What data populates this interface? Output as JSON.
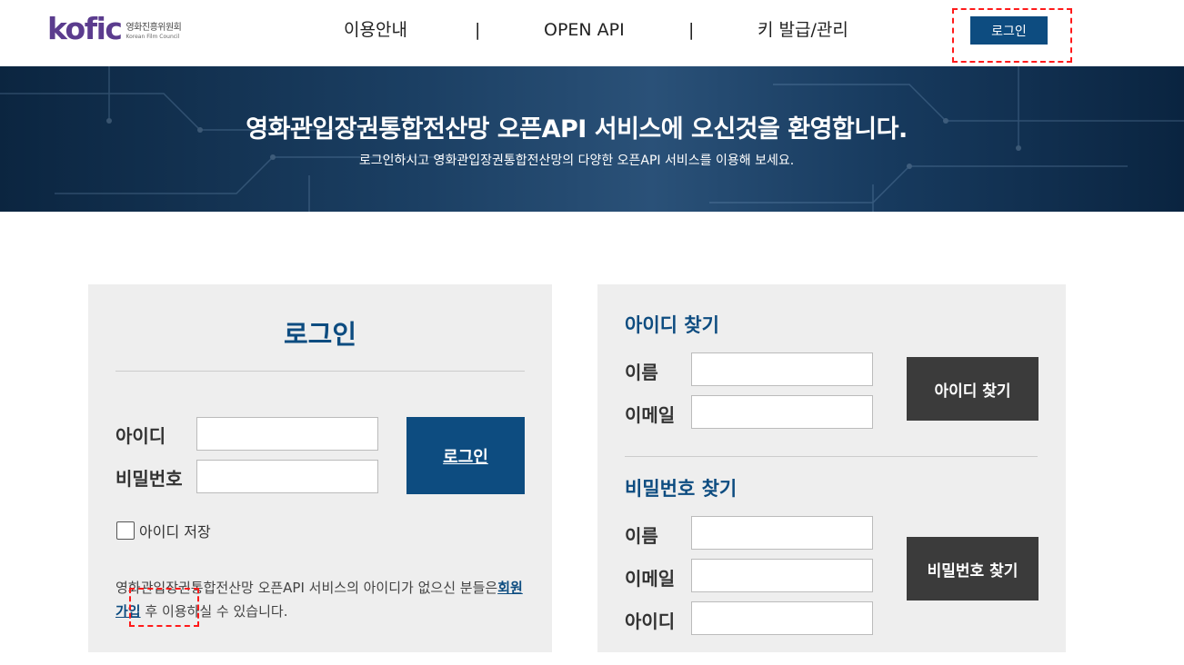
{
  "header": {
    "logo_word": "kofic",
    "logo_ko": "영화진흥위원회",
    "logo_en": "Korean Film Council",
    "nav": [
      "이용안내",
      "OPEN API",
      "키 발급/관리"
    ],
    "nav_separator": "|",
    "login_button": "로그인"
  },
  "banner": {
    "title": "영화관입장권통합전산망 오픈API 서비스에 오신것을 환영합니다.",
    "subtitle": "로그인하시고 영화관입장권통합전산망의 다양한 오픈API 서비스를 이용해 보세요."
  },
  "login": {
    "title": "로그인",
    "id_label": "아이디",
    "password_label": "비밀번호",
    "id_value": "",
    "password_value": "",
    "submit_label": "로그인",
    "remember_label": "아이디 저장",
    "remember_checked": false,
    "signup_text_1": "영화관입장권통합전산망 오픈API 서비스의 아이디가 없으신 분들은",
    "signup_link": "회원가입",
    "signup_text_2": "후 이용하실 수 있습니다."
  },
  "find_id": {
    "title": "아이디 찾기",
    "name_label": "이름",
    "email_label": "이메일",
    "button": "아이디 찾기"
  },
  "find_password": {
    "title": "비밀번호 찾기",
    "name_label": "이름",
    "email_label": "이메일",
    "id_label": "아이디",
    "button": "비밀번호 찾기"
  },
  "colors": {
    "primary": "#0d4c80",
    "dark_button": "#3b3b3b",
    "panel_bg": "#eeeeee",
    "highlight_mark": "#ff1a1a"
  }
}
